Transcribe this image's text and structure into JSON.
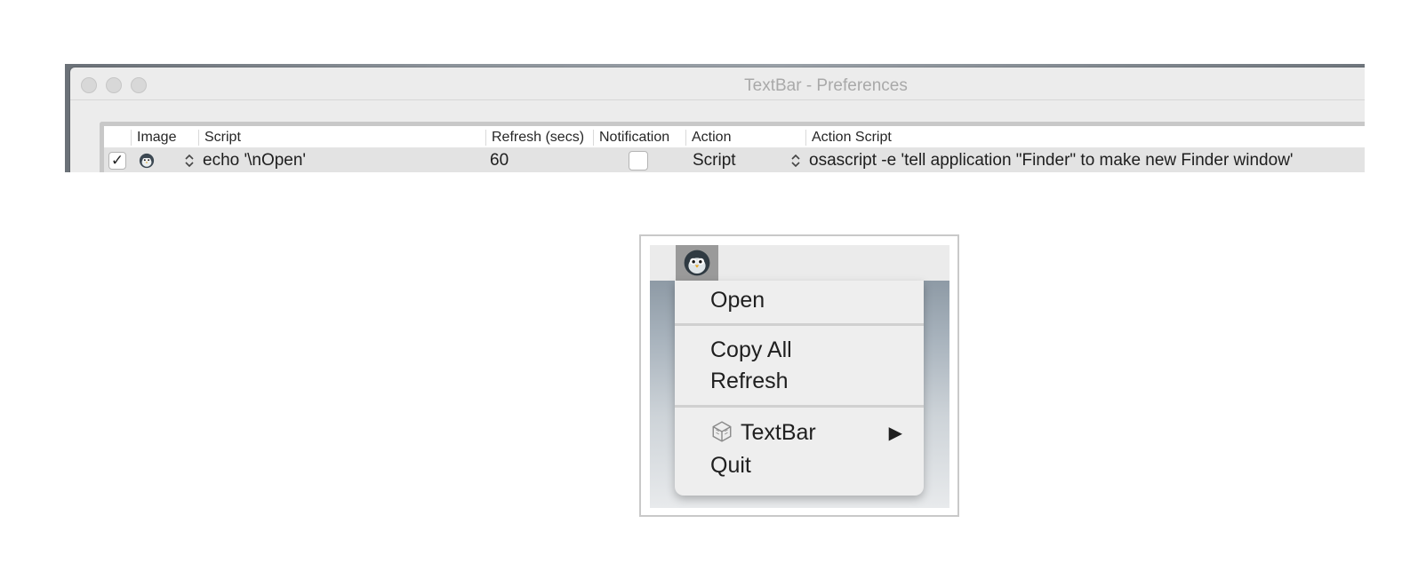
{
  "window": {
    "title": "TextBar - Preferences"
  },
  "table": {
    "columns": [
      {
        "key": "enabled",
        "label": ""
      },
      {
        "key": "image",
        "label": "Image"
      },
      {
        "key": "script",
        "label": "Script"
      },
      {
        "key": "refresh",
        "label": "Refresh (secs)"
      },
      {
        "key": "notification",
        "label": "Notification"
      },
      {
        "key": "action",
        "label": "Action"
      },
      {
        "key": "action_script",
        "label": "Action Script"
      }
    ],
    "rows": [
      {
        "enabled_mark": "✓",
        "image_icon": "penguin-icon",
        "stepper_glyph": "⌃⌄",
        "script": "echo '\\nOpen'",
        "refresh": "60",
        "notification_checked": false,
        "action": "Script",
        "action_script": "osascript -e 'tell application \"Finder\" to make new Finder window'"
      }
    ]
  },
  "menu": {
    "status_icon": "penguin-icon",
    "items": {
      "open": "Open",
      "copy_all": "Copy All",
      "refresh": "Refresh",
      "textbar": "TextBar",
      "quit": "Quit"
    },
    "submenu_arrow": "▶",
    "textbar_icon": "textbar-cube-icon"
  },
  "colors": {
    "selected_row": "#e3e3e3",
    "menu_background": "#eeeeee",
    "status_highlight": "#9a9a9a"
  }
}
